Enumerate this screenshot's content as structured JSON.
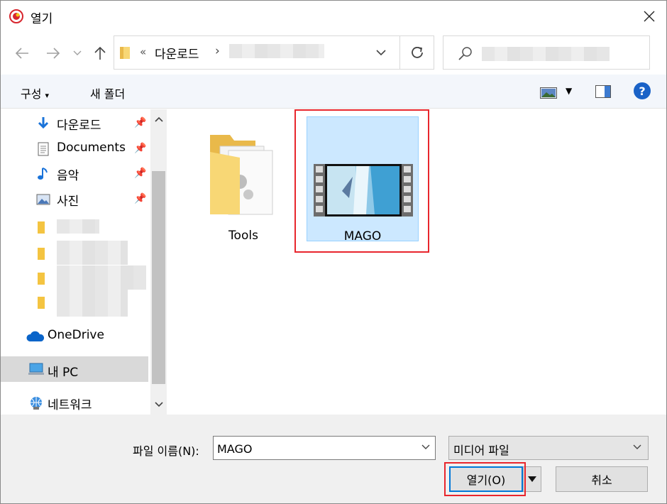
{
  "window": {
    "title": "열기"
  },
  "nav": {
    "path_prefix": "«",
    "path_current": "다운로드",
    "path_separator": "›"
  },
  "toolbar": {
    "organize_label": "구성",
    "new_folder_label": "새 폴더",
    "help_label": "?"
  },
  "sidebar": {
    "items": [
      {
        "label": "다운로드",
        "icon": "download-arrow-icon",
        "pinned": true
      },
      {
        "label": "Documents",
        "icon": "document-icon",
        "pinned": true
      },
      {
        "label": "음악",
        "icon": "music-note-icon",
        "pinned": true
      },
      {
        "label": "사진",
        "icon": "picture-icon",
        "pinned": true
      },
      {
        "label": "OneDrive",
        "icon": "cloud-icon"
      },
      {
        "label": "내 PC",
        "icon": "computer-icon",
        "selected": true
      },
      {
        "label": "네트워크",
        "icon": "network-icon"
      }
    ]
  },
  "files": [
    {
      "name": "Tools",
      "type": "folder"
    },
    {
      "name": "MAGO",
      "type": "video",
      "selected": true
    }
  ],
  "bottom": {
    "filename_label": "파일 이름(N):",
    "filename_value": "MAGO",
    "filetype_value": "미디어 파일",
    "open_label": "열기(O)",
    "cancel_label": "취소"
  },
  "colors": {
    "accent": "#0078d7",
    "selection": "#cce8ff",
    "highlight_box": "#e8262d"
  }
}
